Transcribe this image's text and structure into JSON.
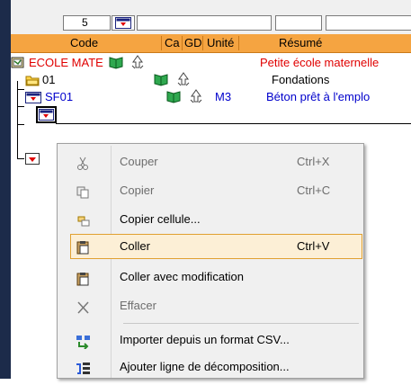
{
  "filter_row": {
    "number": "5"
  },
  "header": {
    "columns": [
      {
        "key": "code",
        "label": "Code"
      },
      {
        "key": "ca",
        "label": "Ca"
      },
      {
        "key": "gd",
        "label": "GD"
      },
      {
        "key": "unite",
        "label": "Unité"
      },
      {
        "key": "resume",
        "label": "Résumé"
      }
    ]
  },
  "tree": {
    "rows": [
      {
        "code": "ECOLE MATE",
        "unit": "",
        "resume": "Petite école maternelle"
      },
      {
        "code": "01",
        "unit": "",
        "resume": "Fondations"
      },
      {
        "code": "SF01",
        "unit": "M3",
        "resume": "Béton prêt à l'emplo"
      }
    ]
  },
  "context_menu": {
    "items": [
      {
        "icon": "scissors-icon",
        "label": "Couper",
        "shortcut": "Ctrl+X",
        "enabled": false
      },
      {
        "icon": "copy-icon",
        "label": "Copier",
        "shortcut": "Ctrl+C",
        "enabled": false
      },
      {
        "icon": "copy-cell-icon",
        "label": "Copier cellule...",
        "shortcut": "",
        "enabled": true
      },
      {
        "icon": "paste-icon",
        "label": "Coller",
        "shortcut": "Ctrl+V",
        "enabled": true,
        "highlighted": true
      },
      {
        "icon": "paste-modify-icon",
        "label": "Coller avec modification",
        "shortcut": "",
        "enabled": true
      },
      {
        "icon": "delete-x-icon",
        "label": "Effacer",
        "shortcut": "",
        "enabled": false
      },
      {
        "icon": "import-csv-icon",
        "label": "Importer depuis un format CSV...",
        "shortcut": "",
        "enabled": true
      },
      {
        "icon": "add-line-icon",
        "label": "Ajouter ligne de décomposition...",
        "shortcut": "",
        "enabled": true
      }
    ]
  },
  "colors": {
    "header_bg": "#f5a441",
    "accent_red": "#e00000",
    "accent_blue": "#0000cc",
    "highlight_bg": "#fcefd6",
    "highlight_border": "#e0a030"
  }
}
